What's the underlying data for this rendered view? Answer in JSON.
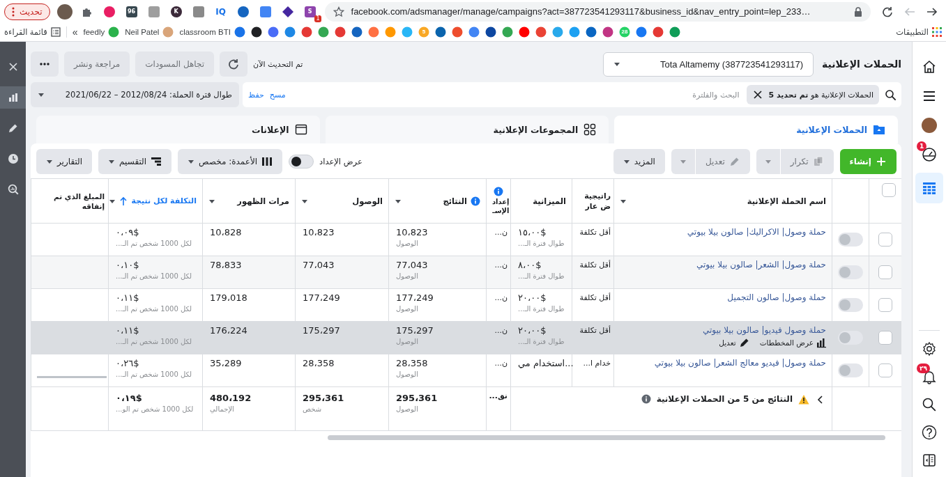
{
  "browser": {
    "update_button": "تحديث",
    "extensions": [
      {
        "kind": "square",
        "color": "#8e44ad",
        "text": "S",
        "badge": "1"
      },
      {
        "kind": "diamond",
        "color": "#4527a0"
      },
      {
        "kind": "square",
        "color": "#4285f4"
      },
      {
        "kind": "round",
        "color": "#1565c0"
      },
      {
        "kind": "plain",
        "color": "#1a73e8",
        "text": "IQ"
      },
      {
        "kind": "square",
        "color": "#8a8a8a"
      },
      {
        "kind": "round",
        "color": "#3c2a3a",
        "text": "K"
      },
      {
        "kind": "square",
        "color": "#9e9e9e"
      },
      {
        "kind": "square",
        "color": "#37474f",
        "text": "96"
      },
      {
        "kind": "round",
        "color": "#e91e63"
      },
      {
        "kind": "puzzle",
        "color": "#5f6368"
      }
    ],
    "url": "facebook.com/adsmanager/manage/campaigns?act=387723541293117&business_id&nav_entry_point=lep_233…",
    "reading_list": "قائمة القراءة",
    "overflow": "»",
    "apps_label": "التطبيقات",
    "bookmarks": [
      {
        "color": "#0f9d58"
      },
      {
        "color": "#e53935"
      },
      {
        "color": "#1877f2"
      },
      {
        "color": "#25d366",
        "text": "28"
      },
      {
        "color": "#c13584"
      },
      {
        "color": "#0a66c2"
      },
      {
        "color": "#1da1f2"
      },
      {
        "color": "#29a9eb"
      },
      {
        "color": "#ea4335"
      },
      {
        "color": "#ff0000"
      },
      {
        "color": "#34a853"
      },
      {
        "color": "#0d47a1"
      },
      {
        "color": "#4285f4"
      },
      {
        "color": "#ee4d2d"
      },
      {
        "color": "#0a64ad"
      },
      {
        "color": "#f9a825",
        "text": "5"
      },
      {
        "color": "#29b6f6"
      },
      {
        "color": "#ff9800"
      },
      {
        "color": "#ff7043"
      },
      {
        "color": "#1565c0"
      },
      {
        "color": "#e53935"
      },
      {
        "color": "#34a853"
      },
      {
        "color": "#e53935"
      },
      {
        "color": "#1e88e5"
      },
      {
        "color": "#4a6cf7"
      },
      {
        "color": "#202124"
      },
      {
        "label": "classroom BTI",
        "color": "#1a73e8"
      },
      {
        "label": "Neil Patel",
        "color": "#d9a57a"
      },
      {
        "label": "feedly",
        "color": "#2bb24c"
      }
    ]
  },
  "tool_rail": [
    {
      "kind": "close",
      "selected": false
    },
    {
      "kind": "chart",
      "selected": true
    },
    {
      "kind": "pencil",
      "selected": false
    },
    {
      "kind": "clock",
      "selected": false
    },
    {
      "kind": "zoom-chart",
      "selected": false
    }
  ],
  "header": {
    "title": "الحملات الإعلانية",
    "account": "Tota Altamemy (387723541293117)",
    "status": "تم التحديث الآن",
    "buttons": [
      {
        "label": "تجاهل المسودات",
        "disabled": true
      },
      {
        "label": "مراجعة ونشر",
        "disabled": true
      }
    ]
  },
  "filter_bar": {
    "chip": "الحملات الإعلانية هو **تم تحديد 5**",
    "placeholder": "البحث والفلترة",
    "links": [
      "مسح",
      "حفظ"
    ],
    "date": "طوال فترة الحملة: 2012/08/24 – 2021/06/22"
  },
  "tabs": [
    {
      "kind": "folder",
      "label": "الحملات الإعلانية",
      "selected": true
    },
    {
      "kind": "grid",
      "label": "المجموعات الإعلانية",
      "selected": false
    },
    {
      "kind": "window",
      "label": "الإعلانات",
      "selected": false
    }
  ],
  "toolbar": {
    "actions": [
      {
        "kind": "create",
        "label": "إنشاء",
        "disabled": false
      },
      {
        "kind": "copy",
        "label": "تكرار",
        "disabled": true
      },
      {
        "kind": "edit",
        "label": "تعديل",
        "disabled": true
      },
      {
        "kind": "more",
        "label": "المزيد",
        "disabled": false
      }
    ],
    "setup_toggle": {
      "label": "عرض الإعداد",
      "on": false
    },
    "views": [
      {
        "kind": "columns",
        "label": "الأعمدة: مخصص"
      },
      {
        "kind": "breakdown",
        "label": "التقسيم"
      },
      {
        "kind": "reports",
        "label": "التقارير"
      }
    ]
  },
  "table": {
    "select_all": {
      "checked": false
    },
    "columns": [
      {
        "label": "اسم الحملة الإعلانية",
        "info": false,
        "sorted": false,
        "caret": true
      },
      {
        "label": "راتيجية ض عار",
        "info": false,
        "sorted": false,
        "caret": false
      },
      {
        "label": "الميزانية",
        "info": false,
        "sorted": false,
        "caret": false
      },
      {
        "label": "إعداد الإسـ",
        "info": true,
        "sorted": false,
        "caret": false
      },
      {
        "label": "النتائج",
        "info": true,
        "sorted": false,
        "caret": true
      },
      {
        "label": "الوصول",
        "info": false,
        "sorted": false,
        "caret": true
      },
      {
        "label": "مرات الظهور",
        "info": false,
        "sorted": false,
        "caret": true
      },
      {
        "label": "التكلفة لكل نتيجة",
        "info": false,
        "sorted": true,
        "caret": true
      },
      {
        "label": "المبلغ الذي تم إنفاقه",
        "info": false,
        "sorted": false,
        "caret": false
      }
    ],
    "rows": [
      {
        "checked": false,
        "active": false,
        "shaded": false,
        "hovered": false,
        "loading": false,
        "name": "حملة وصول| الاكراليك| صالون بيلا بيوتي",
        "strategy": "أقل تكلفة",
        "budget": "١٥،٠٠$",
        "budget_note": "طوال فترة الـ...",
        "attribution": "ن...",
        "results": "10،823",
        "results_note": "الوصول",
        "reach": "10،823",
        "impressions": "10،828",
        "cost": "٠،٠٩$",
        "cost_note": "لكل 1000 شخص تم الـ..."
      },
      {
        "checked": false,
        "active": false,
        "shaded": true,
        "hovered": false,
        "loading": false,
        "name": "حملة وصول| الشعر| صالون بيلا بيوتي",
        "strategy": "أقل تكلفة",
        "budget": "٨،٠٠$",
        "budget_note": "طوال فترة الـ...",
        "attribution": "ن...",
        "results": "77،043",
        "results_note": "الوصول",
        "reach": "77،043",
        "impressions": "78،833",
        "cost": "٠،١٠$",
        "cost_note": "لكل 1000 شخص تم الـ..."
      },
      {
        "checked": false,
        "active": false,
        "shaded": false,
        "hovered": false,
        "loading": false,
        "name": "حملة وصول| صالون التجميل",
        "strategy": "أقل تكلفة",
        "budget": "٢٠،٠٠$",
        "budget_note": "طوال فترة الـ...",
        "attribution": "ن...",
        "results": "177،249",
        "results_note": "الوصول",
        "reach": "177،249",
        "impressions": "179،018",
        "cost": "٠،١١$",
        "cost_note": "لكل 1000 شخص تم الـ..."
      },
      {
        "checked": false,
        "active": false,
        "shaded": false,
        "hovered": true,
        "loading": false,
        "name": "حملة وصول فيديو| صالون بيلا بيوتي",
        "actions": [
          {
            "kind": "chart",
            "label": "عرض المخططات"
          },
          {
            "kind": "edit",
            "label": "تعديل"
          }
        ],
        "strategy": "أقل تكلفة",
        "budget": "٢٠،٠٠$",
        "budget_note": "طوال فترة الـ...",
        "attribution": "ن...",
        "results": "175،297",
        "results_note": "الوصول",
        "reach": "175،297",
        "impressions": "176،224",
        "cost": "٠،١١$",
        "cost_note": "لكل 1000 شخص تم الـ..."
      },
      {
        "checked": false,
        "active": false,
        "shaded": false,
        "hovered": false,
        "loading": true,
        "name": "حملة وصول| فيديو معالج الشعر| صالون بيلا بيوتي",
        "strategy": "خدام ا...",
        "budget": "استخدام مي...",
        "attribution": "ن...",
        "results": "28،358",
        "results_note": "الوصول",
        "reach": "28،358",
        "impressions": "35،289",
        "cost": "٠،٢٦$",
        "cost_note": "لكل 1000 شخص تم الـ..."
      }
    ],
    "summary": {
      "label": "النتائج من 5 من الحملات الإعلانية",
      "attribution": "نق...",
      "results": "295،361",
      "results_note": "الوصول",
      "reach": "295،361",
      "reach_note": "شخص",
      "impressions": "480،192",
      "impressions_note": "الإجمالي",
      "cost": "٠،١٩$",
      "cost_note": "لكل 1000 شخص تم الو..."
    }
  },
  "right_rail": [
    {
      "kind": "home",
      "selected": false
    },
    {
      "kind": "menu",
      "selected": false
    },
    {
      "kind": "avatar",
      "selected": false
    },
    {
      "kind": "gauge",
      "badge": "1",
      "selected": false
    },
    {
      "kind": "table",
      "selected": true
    },
    {
      "kind": "settings",
      "selected": false
    },
    {
      "kind": "bell",
      "badge": "٢٩",
      "selected": false
    },
    {
      "kind": "search",
      "selected": false
    },
    {
      "kind": "help",
      "selected": false
    },
    {
      "kind": "panel",
      "selected": false
    }
  ]
}
